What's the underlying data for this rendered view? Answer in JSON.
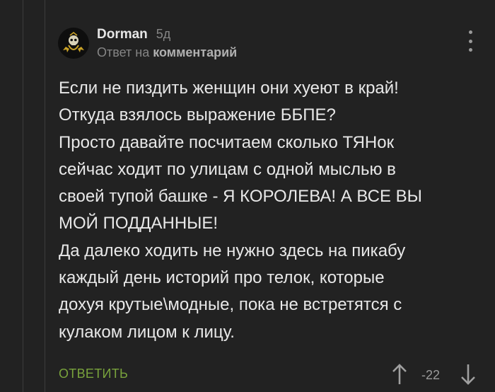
{
  "comment": {
    "author": "Dorman",
    "time": "5д",
    "reply_prefix": "Ответ на",
    "reply_target": "комментарий",
    "body_lines": [
      "Если не пиздить женщин они хуеют в край!",
      "Откуда взялось выражение ББПЕ?",
      "Просто давайте посчитаем сколько ТЯНок",
      "сейчас ходит по улицам с одной мыслью в",
      "своей тупой башке - Я КОРОЛЕВА! А ВСЕ ВЫ",
      "МОЙ ПОДДАННЫЕ!",
      "Да далеко ходить не нужно здесь на пикабу",
      "каждый день историй про телок, которые",
      "дохуя крутые\\модные, пока не встретятся с",
      "кулаком лицом к лицу."
    ],
    "avatar_icon": "skull-emblem-icon",
    "menu_icon": "more-vertical-icon"
  },
  "footer": {
    "reply_label": "ОТВЕТИТЬ",
    "rating": "-22",
    "up_icon": "arrow-up-icon",
    "down_icon": "arrow-down-icon"
  },
  "colors": {
    "background": "#222222",
    "text": "#e8e8e8",
    "muted": "#858585",
    "accent_green": "#79a33c"
  }
}
